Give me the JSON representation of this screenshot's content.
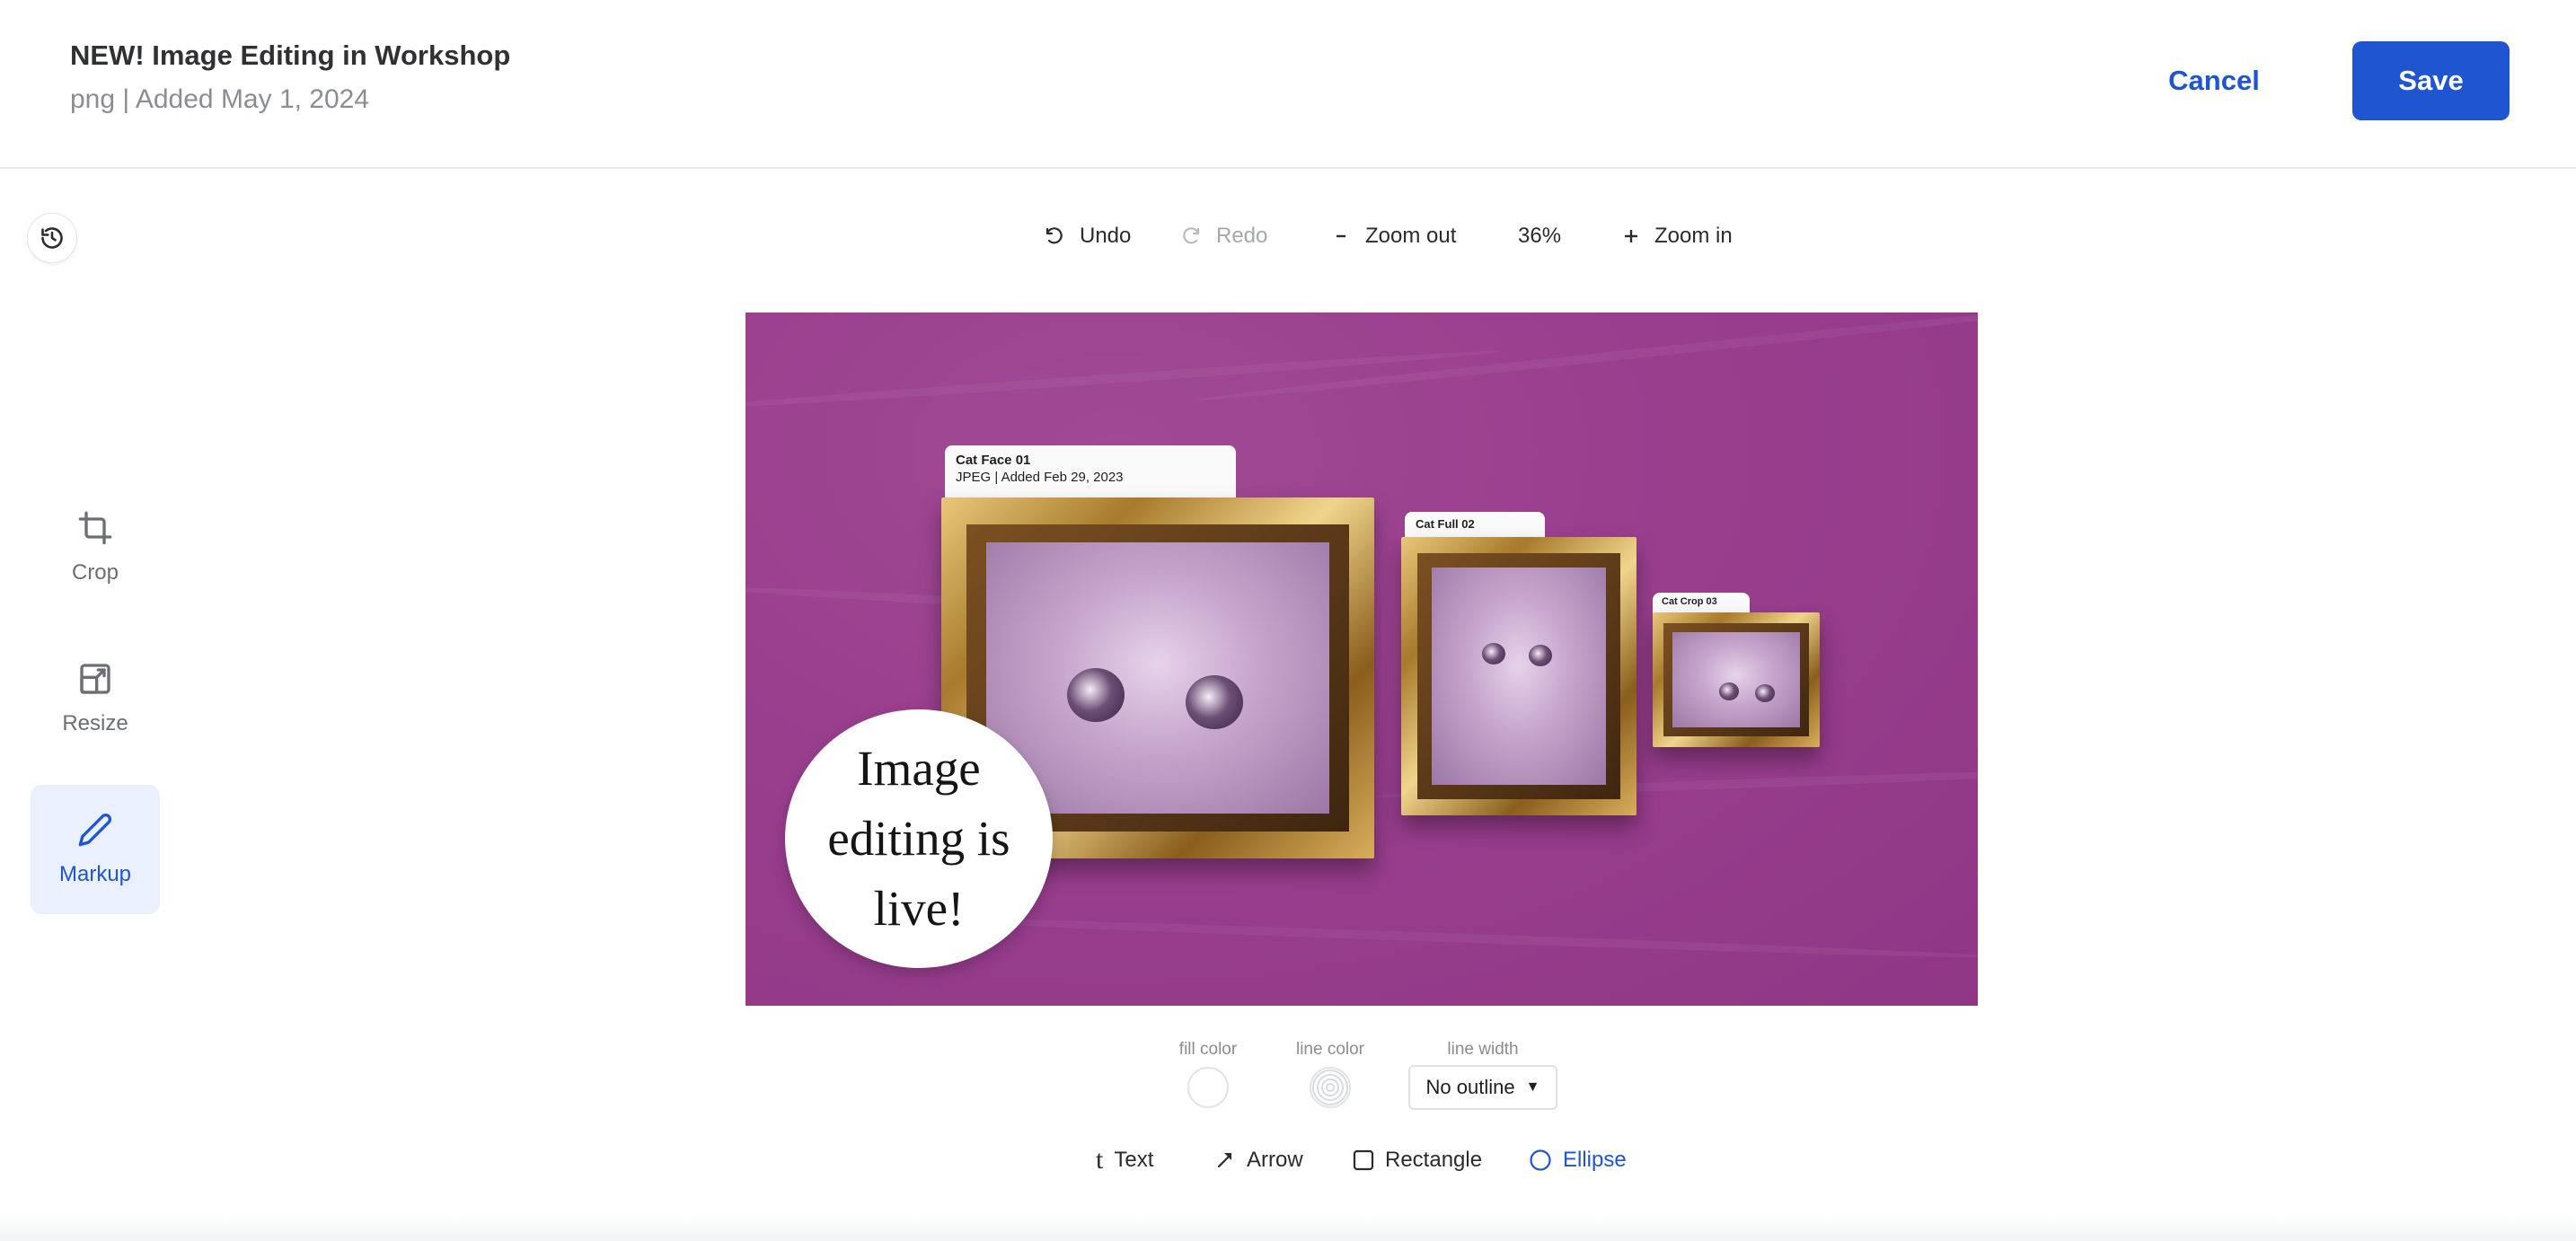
{
  "header": {
    "title": "NEW! Image Editing in Workshop",
    "subtitle": "png | Added May 1, 2024",
    "cancel_label": "Cancel",
    "save_label": "Save"
  },
  "sidebar": {
    "history_icon": "history-icon",
    "tools": [
      {
        "label": "Crop",
        "icon": "crop-icon",
        "active": false
      },
      {
        "label": "Resize",
        "icon": "resize-icon",
        "active": false
      },
      {
        "label": "Markup",
        "icon": "pencil-icon",
        "active": true
      }
    ]
  },
  "toolbar": {
    "undo_label": "Undo",
    "redo_label": "Redo",
    "zoom_out_label": "Zoom out",
    "zoom_level": "36%",
    "zoom_in_label": "Zoom in"
  },
  "canvas": {
    "cards": [
      {
        "title": "Cat Face 01",
        "meta": "JPEG | Added Feb 29, 2023"
      },
      {
        "title": "Cat Full 02"
      },
      {
        "title": "Cat Crop 03"
      }
    ],
    "bubble_text": "Image editing is live!"
  },
  "properties": {
    "fill_color_label": "fill color",
    "line_color_label": "line color",
    "line_width_label": "line width",
    "line_width_value": "No outline"
  },
  "shape_tools": [
    {
      "label": "Text",
      "icon": "text-icon"
    },
    {
      "label": "Arrow",
      "icon": "arrow-icon"
    },
    {
      "label": "Rectangle",
      "icon": "rectangle-icon"
    },
    {
      "label": "Ellipse",
      "icon": "ellipse-icon",
      "active": true
    }
  ],
  "colors": {
    "accent": "#1f55d0",
    "canvas_bg": "#9a3f8e",
    "active_tool_bg": "#eaf0fd"
  }
}
